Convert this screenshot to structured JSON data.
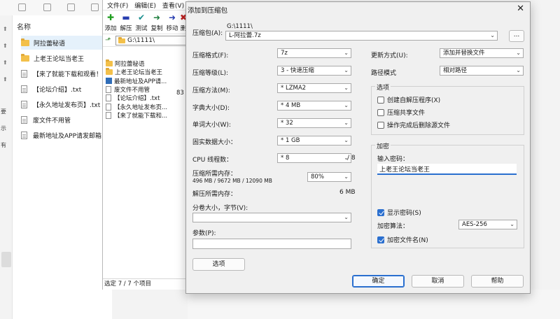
{
  "explorer": {
    "header": "名称",
    "items": [
      {
        "type": "folder",
        "name": "阿拉蕾秘语"
      },
      {
        "type": "folder",
        "name": "上老王论坛当老王"
      },
      {
        "type": "file",
        "name": "【来了就能下载和观看！"
      },
      {
        "type": "file",
        "name": "【论坛介绍】.txt"
      },
      {
        "type": "file",
        "name": "【永久地址发布页】.txt"
      },
      {
        "type": "file",
        "name": "废文件不用管"
      },
      {
        "type": "file",
        "name": "最新地址及APP请发邮箱"
      }
    ],
    "left_edge_chars": [
      "要",
      "示",
      "有"
    ]
  },
  "filemanager": {
    "menu": [
      "文件(F)",
      "编辑(E)",
      "查看(V)"
    ],
    "tools": [
      {
        "label": "添加",
        "icon": "add-icon",
        "color": "#1f9d1f",
        "glyph": "✚"
      },
      {
        "label": "解压",
        "icon": "extract-icon",
        "color": "#2a3fb0",
        "glyph": "▬"
      },
      {
        "label": "测试",
        "icon": "test-icon",
        "color": "#1a8f8f",
        "glyph": "✔"
      },
      {
        "label": "复制",
        "icon": "copy-icon",
        "color": "#1f7f3f",
        "glyph": "➜"
      },
      {
        "label": "移动",
        "icon": "move-icon",
        "color": "#2a3fb0",
        "glyph": "➜"
      },
      {
        "label": "删",
        "icon": "delete-icon",
        "color": "#c02020",
        "glyph": "✖"
      }
    ],
    "address": "G:\\1111\\",
    "rows": [
      {
        "type": "folder",
        "name": "阿拉蕾秘语"
      },
      {
        "type": "folder",
        "name": "上老王论坛当老王"
      },
      {
        "type": "blue",
        "name": "最新地址及APP请..."
      },
      {
        "type": "file",
        "name": "废文件不用管"
      },
      {
        "type": "file",
        "name": "【论坛介绍】.txt"
      },
      {
        "type": "file",
        "name": "【永久地址发布页..."
      },
      {
        "type": "file",
        "name": "【来了就能下载和..."
      }
    ],
    "size_hint": "83",
    "status": "选定 7 / 7 个项目"
  },
  "dialog": {
    "title": "添加到压缩包",
    "archive_label": "压缩包(A):",
    "archive_dir": "G:\\1111\\",
    "archive_name": "L-阿拉蕾.7z",
    "browse_label": "...",
    "format_label": "压缩格式(F):",
    "format_value": "7z",
    "level_label": "压缩等级(L):",
    "level_value": "3 - 快速压缩",
    "method_label": "压缩方法(M):",
    "method_value": "* LZMA2",
    "dict_label": "字典大小(D):",
    "dict_value": "* 4 MB",
    "word_label": "单词大小(W):",
    "word_value": "* 32",
    "solid_label": "固实数据大小：",
    "solid_value": "* 1 GB",
    "cpu_label": "CPU 线程数：",
    "cpu_value": "* 8",
    "cpu_max": "/ 8",
    "mem_label": "压缩所需内存：",
    "mem_detail": "496 MB / 9672 MB / 12090 MB",
    "mem_percent": "80%",
    "demem_label": "解压所需内存：",
    "demem_value": "6 MB",
    "split_label": "分卷大小，字节(V):",
    "split_value": "",
    "params_label": "参数(P):",
    "params_value": "",
    "options_button": "选项",
    "update_label": "更新方式(U):",
    "update_value": "添加并替换文件",
    "path_label": "路径模式",
    "path_value": "相对路径",
    "options_group": "选项",
    "opt_sfx": "创建自解压程序(X)",
    "opt_sfx_checked": false,
    "opt_shared": "压缩共享文件",
    "opt_shared_checked": false,
    "opt_delete": "操作完成后删除源文件",
    "opt_delete_checked": false,
    "encrypt_group": "加密",
    "pw_label": "输入密码：",
    "pw_value": "上老王论坛当老王",
    "show_pw": "显示密码(S)",
    "show_pw_checked": true,
    "enc_method_label": "加密算法：",
    "enc_method_value": "AES-256",
    "enc_names": "加密文件名(N)",
    "enc_names_checked": true,
    "ok": "确定",
    "cancel": "取消",
    "help": "帮助",
    "accent": "#2a6fcf"
  }
}
